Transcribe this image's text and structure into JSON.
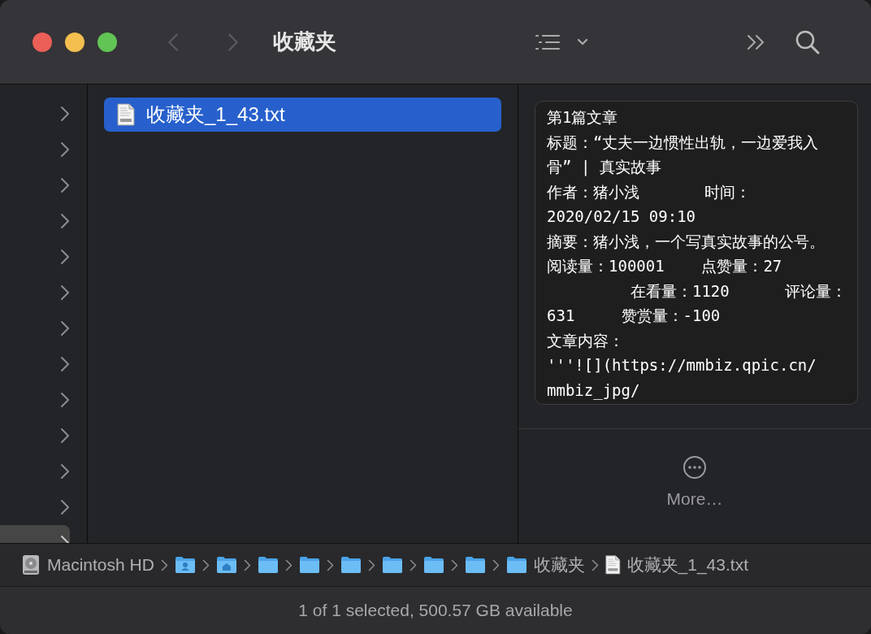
{
  "window": {
    "title": "收藏夹",
    "back_disabled": true,
    "forward_disabled": true
  },
  "parent_column": {
    "items": [
      {
        "selected": false
      },
      {
        "selected": false
      },
      {
        "selected": false
      },
      {
        "selected": false
      },
      {
        "selected": false
      },
      {
        "selected": false
      },
      {
        "selected": false
      },
      {
        "selected": false
      },
      {
        "selected": false
      },
      {
        "selected": false
      },
      {
        "selected": false
      },
      {
        "selected": false
      },
      {
        "selected": true
      }
    ]
  },
  "files": [
    {
      "name": "收藏夹_1_43.txt",
      "selected": true
    }
  ],
  "preview": {
    "lines": [
      "第1篇文章",
      "标题：“丈夫一边惯性出轨，一边爱我入",
      "骨” | 真实故事",
      "作者：猪小浅       时间：",
      "2020/02/15 09:10",
      "摘要：猪小浅，一个写真实故事的公号。",
      "阅读量：100001    点赞量：27",
      "         在看量：1120      评论量：",
      "631     赞赏量：-100",
      "文章内容：",
      "'''![](https://mmbiz.qpic.cn/",
      "mmbiz_jpg/"
    ],
    "more_label": "More…"
  },
  "path_bar": [
    {
      "kind": "disk",
      "label": "Macintosh HD"
    },
    {
      "kind": "user-folder"
    },
    {
      "kind": "home-folder"
    },
    {
      "kind": "folder"
    },
    {
      "kind": "folder"
    },
    {
      "kind": "folder"
    },
    {
      "kind": "folder"
    },
    {
      "kind": "folder"
    },
    {
      "kind": "folder"
    },
    {
      "kind": "folder",
      "label": "收藏夹"
    },
    {
      "kind": "file",
      "label": "收藏夹_1_43.txt"
    }
  ],
  "status_bar": "1 of 1 selected, 500.57 GB available"
}
